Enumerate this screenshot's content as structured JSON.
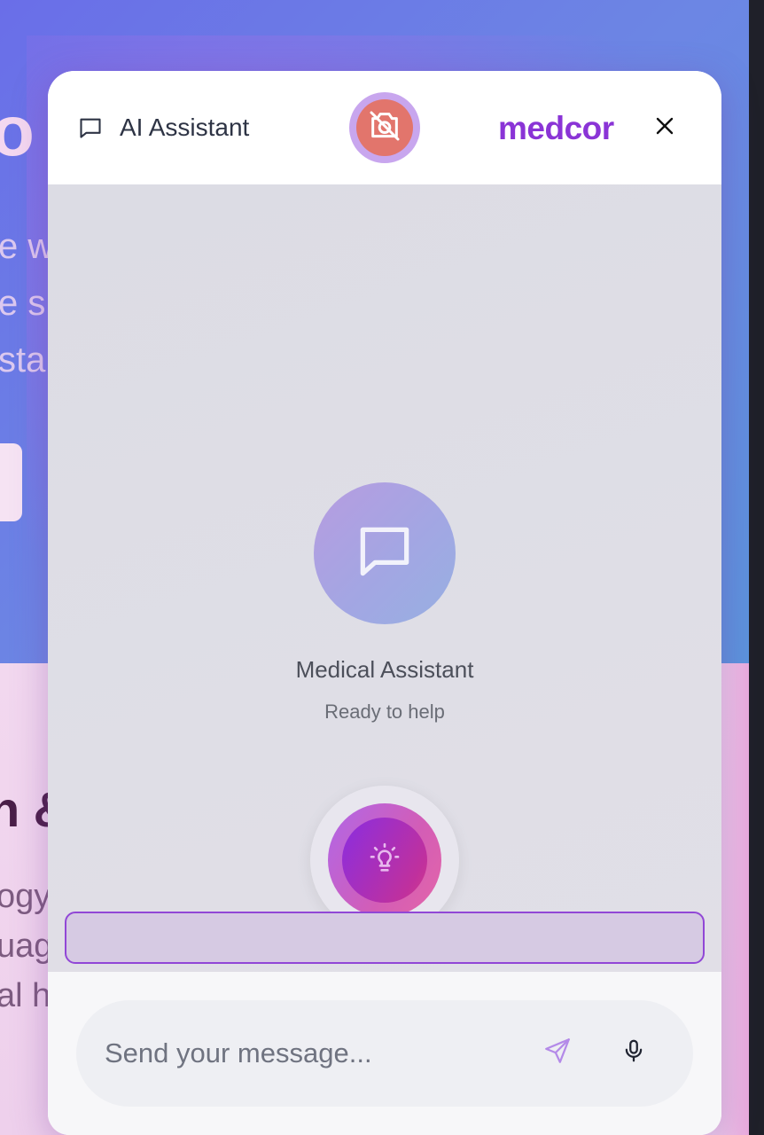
{
  "background_page": {
    "hero_title_fragment": "o",
    "hero_lines": [
      "e w",
      "e s",
      "sta"
    ],
    "lower_title_fragment": "n &",
    "lower_lines": [
      "ogy",
      "uag",
      "al h"
    ]
  },
  "header": {
    "title": "AI Assistant",
    "brand": "medcor",
    "camera_icon": "camera-off-icon",
    "close_icon": "close-icon",
    "chat_icon": "chat-bubble-icon"
  },
  "assistant": {
    "name": "Medical Assistant",
    "status": "Ready to help",
    "avatar_icon": "chat-bubble-icon",
    "orb_icon": "lightbulb-icon"
  },
  "composer": {
    "placeholder": "Send your message...",
    "value": "",
    "send_icon": "send-icon",
    "mic_icon": "microphone-icon"
  },
  "colors": {
    "brand": "#8a34d6",
    "camera_off": "#e2756c",
    "accent_border": "#9147d6"
  }
}
